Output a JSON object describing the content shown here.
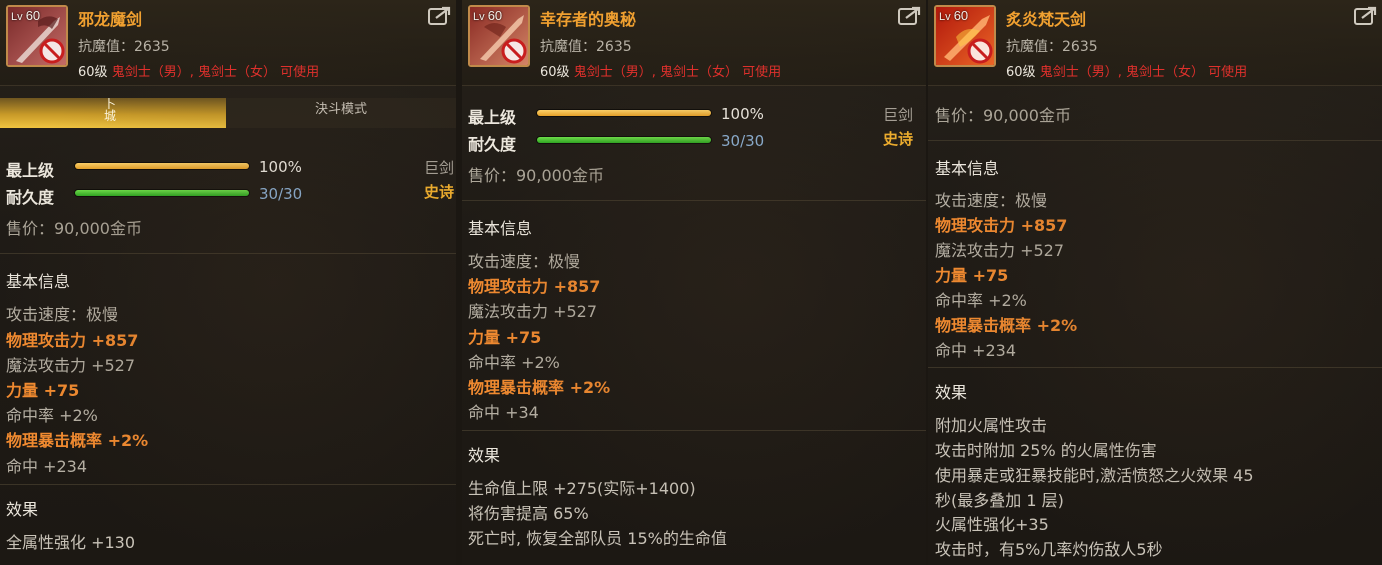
{
  "panels": [
    {
      "level_prefix": "Lv",
      "level": "60",
      "name": "邪龙魔剑",
      "anti_magic": "抗魔值：2635",
      "level_req": "60级",
      "classes": "鬼剑士（男）, 鬼剑士（女）",
      "usable": "可使用",
      "tabs": [
        "卜\n城",
        "決斗模式"
      ],
      "top_rows": [
        {
          "label": "最上级",
          "value": "100%",
          "fill": 1.0,
          "color": "gold"
        },
        {
          "label": "耐久度",
          "value": "30/30",
          "fill": 1.0,
          "color": "green"
        }
      ],
      "weapon_type": "巨剑",
      "rarity": "史诗",
      "price": "售价：90,000金币",
      "basic_title": "基本信息",
      "stats": [
        {
          "text": "攻击速度：极慢",
          "style": "gray"
        },
        {
          "text": "物理攻击力 +857",
          "style": "orange"
        },
        {
          "text": "魔法攻击力 +527",
          "style": "gray"
        },
        {
          "text": "力量 +75",
          "style": "orange"
        },
        {
          "text": "命中率 +2%",
          "style": "gray"
        },
        {
          "text": "物理暴击概率 +2%",
          "style": "orange"
        },
        {
          "text": "命中 +234",
          "style": "gray"
        }
      ],
      "effect_title": "效果",
      "effects": [
        "全属性强化 +130"
      ]
    },
    {
      "level_prefix": "Lv",
      "level": "60",
      "name": "幸存者的奥秘",
      "anti_magic": "抗魔值：2635",
      "level_req": "60级",
      "classes": "鬼剑士（男）, 鬼剑士（女）",
      "usable": "可使用",
      "top_rows": [
        {
          "label": "最上级",
          "value": "100%",
          "fill": 1.0,
          "color": "gold"
        },
        {
          "label": "耐久度",
          "value": "30/30",
          "fill": 1.0,
          "color": "green"
        }
      ],
      "weapon_type": "巨剑",
      "rarity": "史诗",
      "price": "售价：90,000金币",
      "basic_title": "基本信息",
      "stats": [
        {
          "text": "攻击速度：极慢",
          "style": "gray"
        },
        {
          "text": "物理攻击力 +857",
          "style": "orange"
        },
        {
          "text": "魔法攻击力 +527",
          "style": "gray"
        },
        {
          "text": "力量 +75",
          "style": "orange"
        },
        {
          "text": "命中率 +2%",
          "style": "gray"
        },
        {
          "text": "物理暴击概率 +2%",
          "style": "orange"
        },
        {
          "text": "命中 +34",
          "style": "gray"
        }
      ],
      "effect_title": "效果",
      "effects": [
        "生命值上限 +275(实际+1400)",
        "将伤害提高 65%",
        "死亡时, 恢复全部队员 15%的生命值"
      ]
    },
    {
      "level_prefix": "Lv",
      "level": "60",
      "name": "炙炎梵天剑",
      "anti_magic": "抗魔值：2635",
      "level_req": "60级",
      "classes": "鬼剑士（男）, 鬼剑士（女）",
      "usable": "可使用",
      "price": "售价：90,000金币",
      "basic_title": "基本信息",
      "stats": [
        {
          "text": "攻击速度：极慢",
          "style": "gray"
        },
        {
          "text": "物理攻击力 +857",
          "style": "orange"
        },
        {
          "text": "魔法攻击力 +527",
          "style": "gray"
        },
        {
          "text": "力量 +75",
          "style": "orange"
        },
        {
          "text": "命中率 +2%",
          "style": "gray"
        },
        {
          "text": "物理暴击概率 +2%",
          "style": "orange"
        },
        {
          "text": "命中 +234",
          "style": "gray"
        }
      ],
      "effect_title": "效果",
      "effects": [
        "附加火属性攻击",
        "攻击时附加 25% 的火属性伤害",
        "使用暴走或狂暴技能时,激活愤怒之火效果 45",
        "秒(最多叠加 1 层)",
        "火属性强化+35",
        "攻击时，有5%几率灼伤敌人5秒"
      ]
    }
  ],
  "icons": {
    "weapon_1": "dragon-sword-icon",
    "weapon_2": "survivor-sword-icon",
    "weapon_3": "flame-sword-icon",
    "unusable_mark": "prohibited-icon",
    "share": "share-icon"
  },
  "colors": {
    "item_name": "#f0a030",
    "class_red": "#e5302c",
    "orange_stat": "#f08a30",
    "rarity_epic": "#f3b12e"
  }
}
